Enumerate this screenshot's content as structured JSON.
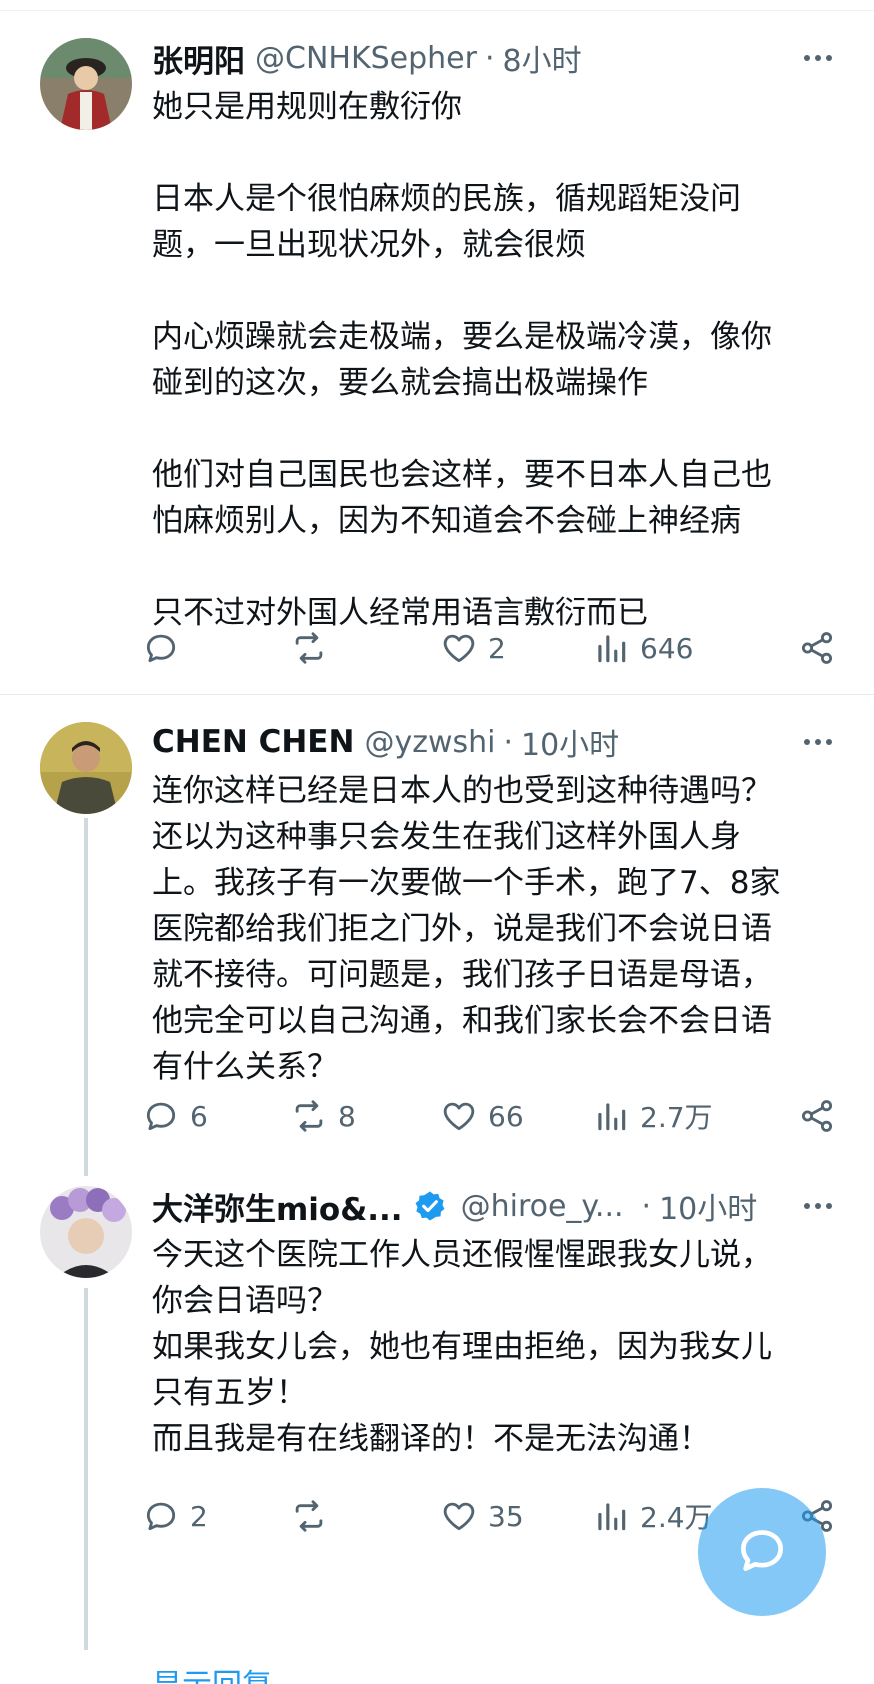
{
  "posts": [
    {
      "name": "张明阳",
      "handle": "@CNHKSepher",
      "dot": "·",
      "time": "8小时",
      "verified": false,
      "text": "她只是用规则在敷衍你\n\n日本人是个很怕麻烦的民族，循规蹈矩没问\n题，一旦出现状况外，就会很烦\n\n内心烦躁就会走极端，要么是极端冷漠，像你\n碰到的这次，要么就会搞出极端操作\n\n他们对自己国民也会这样，要不日本人自己也\n怕麻烦别人，因为不知道会不会碰上神经病\n\n只不过对外国人经常用语言敷衍而已",
      "replies": "",
      "reposts": "",
      "likes": "2",
      "views": "646"
    },
    {
      "name": "CHEN CHEN",
      "handle": "@yzwshi",
      "dot": "·",
      "time": "10小时",
      "verified": false,
      "text": "连你这样已经是日本人的也受到这种待遇吗？\n还以为这种事只会发生在我们这样外国人身\n上。我孩子有一次要做一个手术，跑了7、8家\n医院都给我们拒之门外，说是我们不会说日语\n就不接待。可问题是，我们孩子日语是母语，\n他完全可以自己沟通，和我们家长会不会日语\n有什么关系？",
      "replies": "6",
      "reposts": "8",
      "likes": "66",
      "views": "2.7万"
    },
    {
      "name": "大洋弥生mio&...",
      "handle": "@hiroe_y...",
      "dot": "·",
      "time": "10小时",
      "verified": true,
      "text": "今天这个医院工作人员还假惺惺跟我女儿说，\n你会日语吗？\n如果我女儿会，她也有理由拒绝，因为我女儿\n只有五岁！\n而且我是有在线翻译的！不是无法沟通！",
      "replies": "2",
      "reposts": "",
      "likes": "35",
      "views": "2.4万"
    }
  ],
  "colors": {
    "text": "#0f1419",
    "muted": "#536471",
    "accent": "#1d9bf0",
    "thread_line": "#cfd9de"
  },
  "icons": [
    "reply-icon",
    "repost-icon",
    "like-icon",
    "views-icon",
    "share-icon",
    "more-icon",
    "verified-icon",
    "compose-icon"
  ],
  "bottom_peek": "显示回复"
}
